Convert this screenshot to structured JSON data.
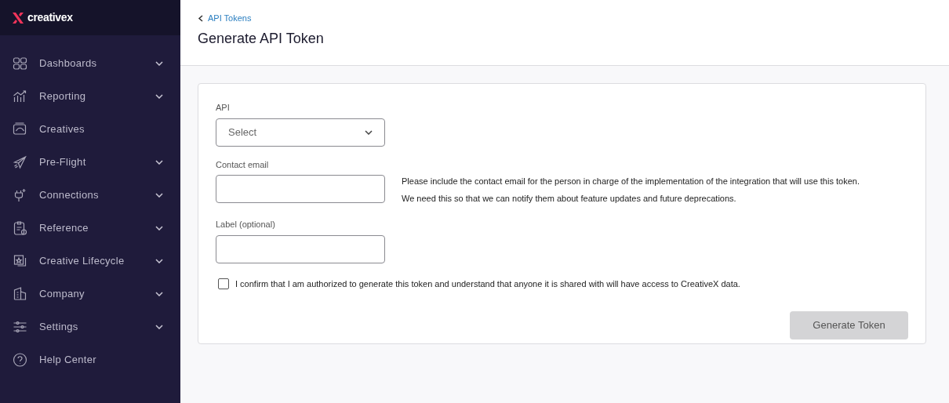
{
  "sidebar": {
    "logo": "creativex",
    "items": [
      {
        "label": "Dashboards",
        "expandable": true
      },
      {
        "label": "Reporting",
        "expandable": true
      },
      {
        "label": "Creatives",
        "expandable": false
      },
      {
        "label": "Pre-Flight",
        "expandable": true
      },
      {
        "label": "Connections",
        "expandable": true
      },
      {
        "label": "Reference",
        "expandable": true
      },
      {
        "label": "Creative Lifecycle",
        "expandable": true
      },
      {
        "label": "Company",
        "expandable": true
      },
      {
        "label": "Settings",
        "expandable": true
      },
      {
        "label": "Help Center",
        "expandable": false
      }
    ]
  },
  "header": {
    "back_link": "API Tokens",
    "title": "Generate API Token"
  },
  "form": {
    "api": {
      "label": "API",
      "placeholder": "Select"
    },
    "contact_email": {
      "label": "Contact email",
      "help_lines": [
        "Please include the contact email for the person in charge of the implementation of the integration that will use this token.",
        "We need this so that we can notify them about feature updates and future deprecations."
      ]
    },
    "label_field": {
      "label": "Label (optional)"
    },
    "confirm": {
      "label": "I confirm that I am authorized to generate this token and understand that anyone it is shared with will have access to CreativeX data.",
      "checked": false
    },
    "submit": {
      "label": "Generate Token",
      "disabled": true
    }
  }
}
